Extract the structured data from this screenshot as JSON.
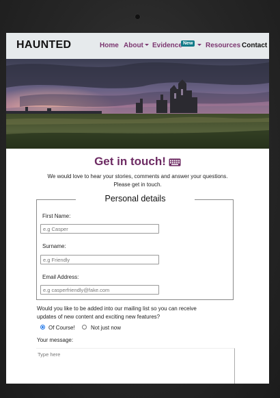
{
  "brand": "HAUNTED",
  "nav": {
    "home": "Home",
    "about": "About",
    "evidence": "Evidence",
    "evidence_badge": "New",
    "resources": "Resources",
    "contact": "Contact"
  },
  "colors": {
    "brand_purple": "#7b3670",
    "heading_purple": "#6d2b63",
    "badge_teal": "#0f7a88",
    "navbar_bg": "#e6eaec"
  },
  "contact": {
    "title": "Get in touch!",
    "title_icon": "keyboard-icon",
    "intro_line1": "We would love to hear your stories, comments and answer your questions.",
    "intro_line2": "Please get in touch."
  },
  "form": {
    "legend": "Personal details",
    "first_name_label": "First Name:",
    "first_name_placeholder": "e.g Casper",
    "surname_label": "Surname:",
    "surname_placeholder": "e.g Friendly",
    "email_label": "Email Address:",
    "email_placeholder": "e.g casperfriendly@fake.com",
    "mailing_question_line1": "Would you like to be added into our mailing list so you can receive",
    "mailing_question_line2": "updates of new content and exciting new features?",
    "option_yes": "Of Course!",
    "option_no": "Not just now",
    "selected_option": "Of Course!",
    "message_label": "Your message:",
    "message_placeholder": "Type here"
  }
}
